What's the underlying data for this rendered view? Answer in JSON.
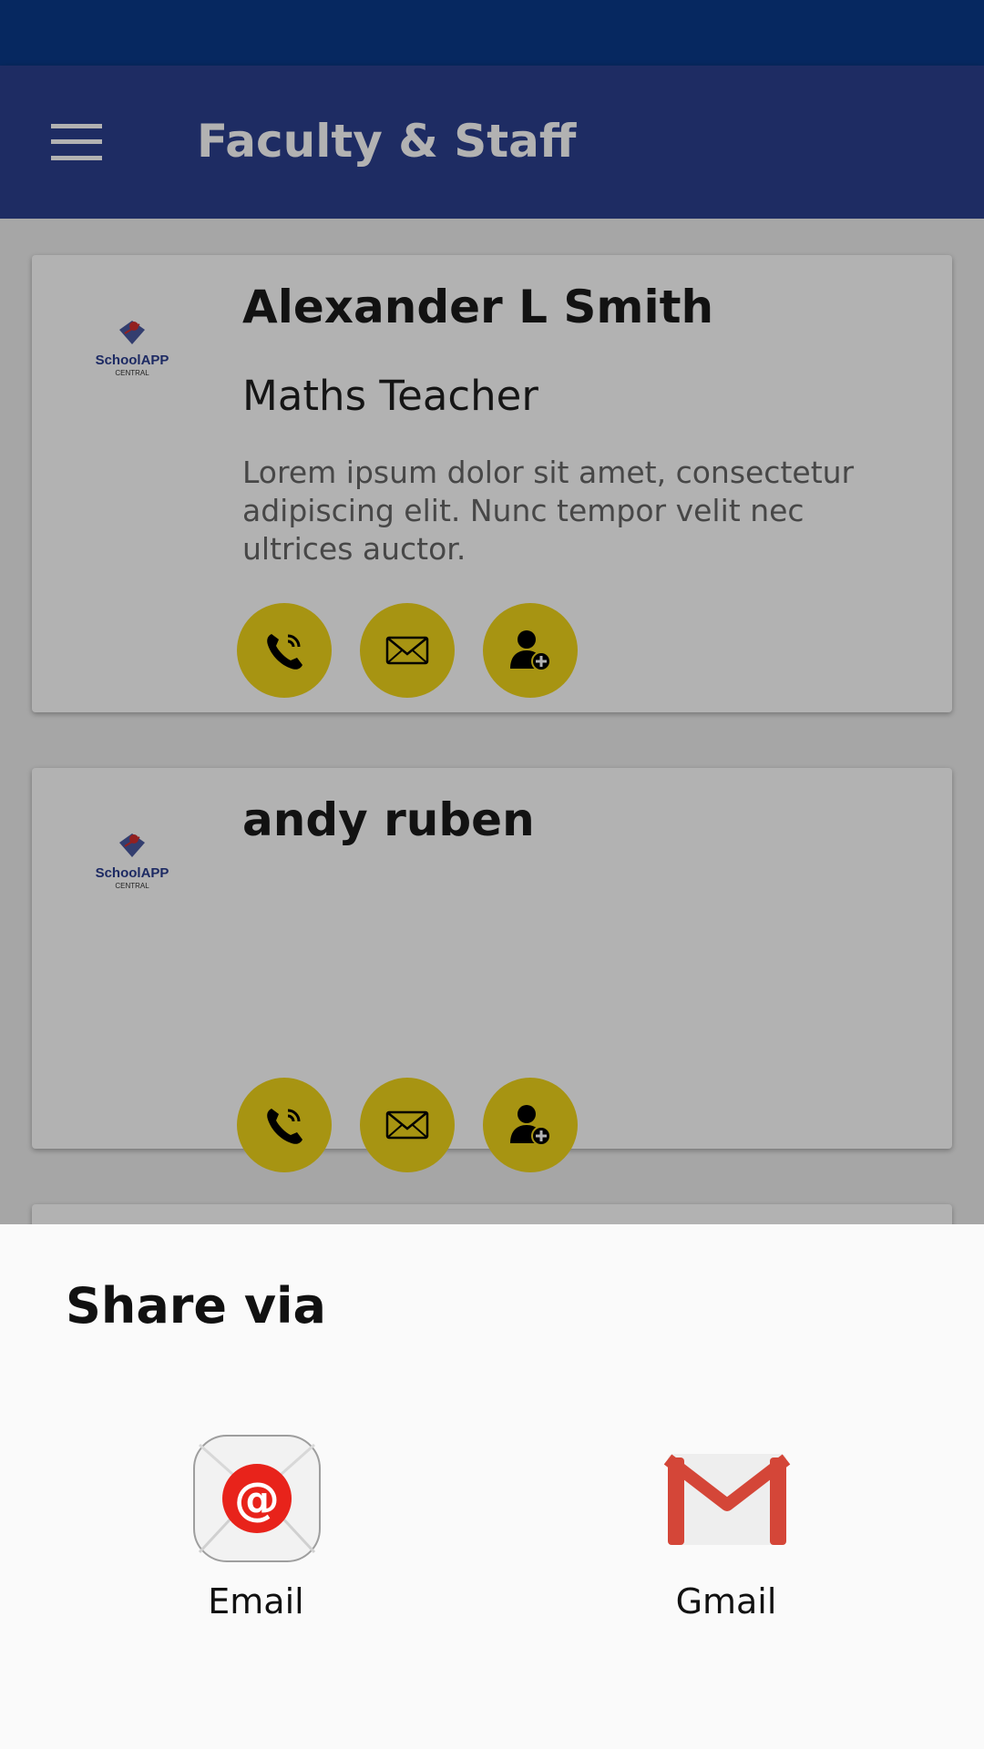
{
  "app_bar": {
    "title": "Faculty & Staff",
    "menu_icon": "hamburger-menu-icon"
  },
  "staff": [
    {
      "name": "Alexander L Smith",
      "role": "Maths Teacher",
      "description": "Lorem ipsum dolor sit amet, consectetur adipiscing elit. Nunc tempor velit nec ultrices auctor.",
      "logo_text": "SchoolAPP",
      "logo_subtext": "CENTRAL"
    },
    {
      "name": "andy ruben",
      "role": "",
      "description": "",
      "logo_text": "SchoolAPP",
      "logo_subtext": "CENTRAL"
    }
  ],
  "action_icons": [
    "phone-icon",
    "mail-icon",
    "add-contact-icon"
  ],
  "share_sheet": {
    "title": "Share via",
    "options": [
      {
        "label": "Email",
        "icon": "email-app-icon"
      },
      {
        "label": "Gmail",
        "icon": "gmail-icon"
      }
    ]
  },
  "colors": {
    "status_bar": "#0a3a8a",
    "app_bar": "#2c3f8e",
    "action_button": "#f0d51a",
    "sheet": "#fafafa"
  }
}
